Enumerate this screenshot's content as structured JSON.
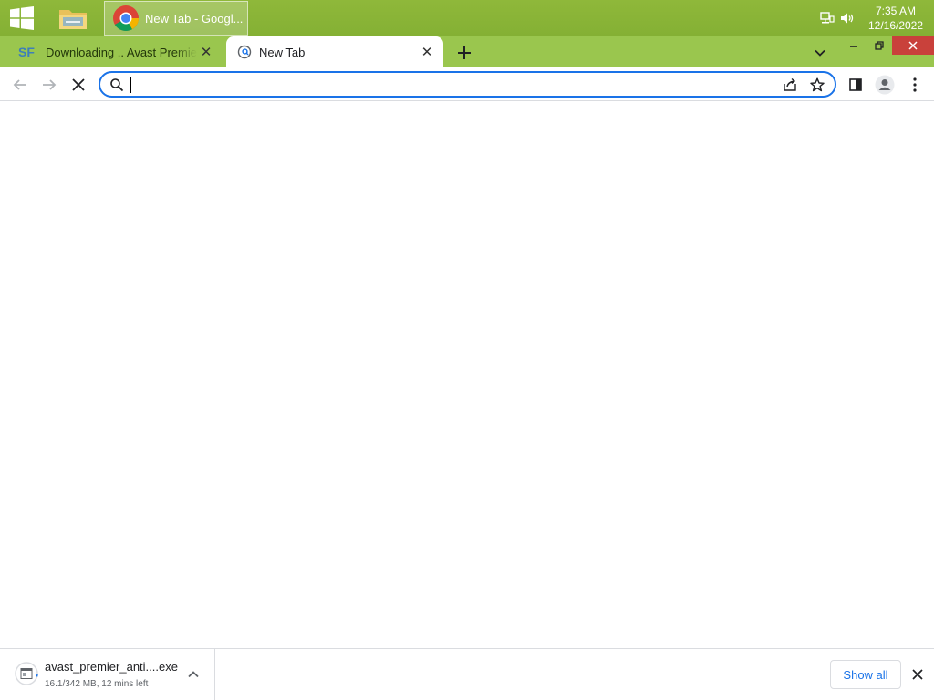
{
  "taskbar": {
    "active_app_label": "New Tab - Googl...",
    "clock_time": "7:35 AM",
    "clock_date": "12/16/2022",
    "start_icon": "windows-logo",
    "explorer_icon": "file-explorer",
    "tray_icons": [
      "network-icon",
      "volume-icon"
    ]
  },
  "browser": {
    "tabs": [
      {
        "favicon": "SF",
        "title": "Downloading .. Avast Premier - Soft",
        "active": false
      },
      {
        "favicon": "globe",
        "title": "New Tab",
        "active": true
      }
    ],
    "new_tab_icon": "+",
    "omnibox": {
      "value": "",
      "placeholder": ""
    },
    "window_controls": [
      "minimize",
      "restore",
      "close"
    ]
  },
  "download": {
    "filename": "avast_premier_anti....exe",
    "status": "16.1/342 MB, 12 mins left",
    "show_all_label": "Show all"
  },
  "colors": {
    "taskbar": "#8fb83a",
    "tabstrip": "#9ac64e",
    "accent": "#1a73e8",
    "close_button": "#c9413b"
  }
}
